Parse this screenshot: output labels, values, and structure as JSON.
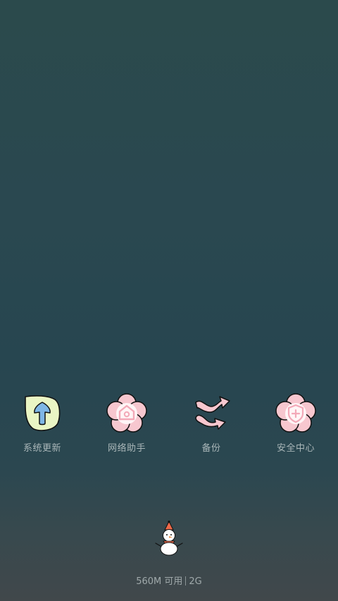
{
  "apps": [
    {
      "label": "系统更新",
      "icon": "system-update-icon"
    },
    {
      "label": "网络助手",
      "icon": "network-assistant-icon"
    },
    {
      "label": "备份",
      "icon": "backup-icon"
    },
    {
      "label": "安全中心",
      "icon": "security-center-icon"
    }
  ],
  "footer": {
    "memory_free": "560M 可用",
    "memory_total": "2G",
    "mascot_icon": "snowman-icon"
  },
  "colors": {
    "background_top": "#2b4a4c",
    "background_bottom": "#41484b",
    "label_text": "#a9b6b8",
    "update_icon_fill": "#eaf5c4",
    "update_arrow": "#7fb6e6",
    "flower_pink": "#f7c7cf",
    "accent_pink": "#f3a9b8"
  }
}
